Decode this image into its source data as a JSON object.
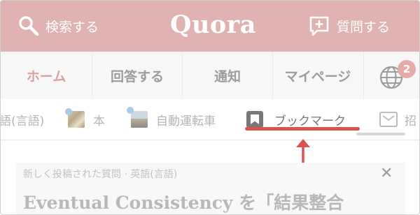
{
  "header": {
    "search_label": "検索する",
    "logo": "Quora",
    "ask_label": "質問する",
    "color": "#e0b3b2"
  },
  "nav": {
    "items": [
      {
        "label": "ホーム",
        "active": true
      },
      {
        "label": "回答する",
        "active": false
      },
      {
        "label": "通知",
        "active": false
      },
      {
        "label": "マイページ",
        "active": false
      }
    ],
    "notification_count": "2",
    "active_color": "#d7a2a0"
  },
  "topics": {
    "items": [
      {
        "label": "語(言語)"
      },
      {
        "label": "本"
      },
      {
        "label": "自動運転車"
      },
      {
        "label": "ブックマーク",
        "active": true
      },
      {
        "label": "招"
      }
    ],
    "active_underline_color": "#d9534f"
  },
  "annotation": {
    "arrow_color": "#d9534f"
  },
  "card": {
    "meta": "新しく投稿された質問 · 英語(言語)",
    "close": "✕",
    "title": "Eventual Consistency を「結果整合"
  }
}
